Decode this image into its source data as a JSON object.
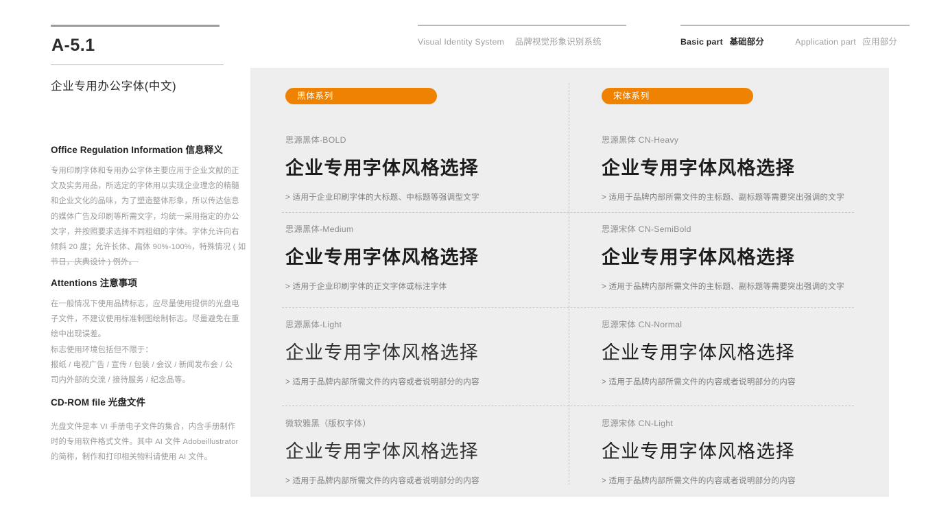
{
  "sidebar": {
    "page_code": "A-5.1",
    "title": "企业专用办公字体(中文)",
    "sections": [
      {
        "heading_en": "Office Regulation Information",
        "heading_cn": "信息释义",
        "body_lines": [
          "专用印刷字体和专用办公字体主要应用于企业文献的正",
          "文及实务用品，所选定的字体用以实现企业理念的精髓",
          "和企业文化的品味，为了塑造整体形象，所以传达信息",
          "的媒体广告及印刷等所需文字，均统一采用指定的办公",
          "文字，并按照要求选择不同粗细的字体。字体允许向右",
          "倾斜 20 度；允许长体、扁体 90%-100%，特殊情况 ( 如",
          "节日，庆典设计 ) 例外。"
        ]
      },
      {
        "heading_en": "Attentions",
        "heading_cn": "注意事项",
        "body_lines": [
          "在一般情况下使用品牌标志，应尽量使用提供的光盘电",
          "子文件，不建议使用标准制图绘制标志。尽量避免在重",
          "绘中出现误差。",
          "标志使用环境包括但不限于：",
          "报纸 / 电视广告 / 宣传 / 包装 / 会议 / 新闻发布会 / 公",
          "司内外部的交流 / 接待服务 / 纪念品等。"
        ]
      },
      {
        "heading_en": "CD-ROM file",
        "heading_cn": "光盘文件",
        "body_lines": [
          "光盘文件是本 VI 手册电子文件的集合，内含手册制作",
          "时的专用软件格式文件。其中 AI 文件 Adobeillustrator",
          "的简称，制作和打印相关物料请使用 AI 文件。"
        ]
      }
    ]
  },
  "header": {
    "left_group": [
      {
        "en": "Visual Identity System",
        "cn": "品牌视觉形象识别系统",
        "active": false
      }
    ],
    "right_group": [
      {
        "en": "Basic part",
        "cn": "基础部分",
        "active": true
      },
      {
        "en": "Application part",
        "cn": "应用部分",
        "active": false
      }
    ]
  },
  "panel": {
    "accent_color": "#ef8200",
    "background_color": "#eeeeee",
    "badges": {
      "left": "黑体系列",
      "right": "宋体系列"
    },
    "left_column": [
      {
        "name": "思源黑体-BOLD",
        "sample": "企业专用字体风格选择",
        "note": "> 适用于企业印刷字体的大标题、中标题等强调型文字"
      },
      {
        "name": "思源黑体-Medium",
        "sample": "企业专用字体风格选择",
        "note": "> 适用于企业印刷字体的正文字体或标注字体"
      },
      {
        "name": "思源黑体-Light",
        "sample": "企业专用字体风格选择",
        "note": "> 适用于品牌内部所需文件的内容或者说明部分的内容"
      },
      {
        "name": "微软雅黑（版权字体）",
        "sample": "企业专用字体风格选择",
        "note": "> 适用于品牌内部所需文件的内容或者说明部分的内容"
      }
    ],
    "right_column": [
      {
        "name": "思源黑体 CN-Heavy",
        "sample": "企业专用字体风格选择",
        "note": "> 适用于品牌内部所需文件的主标题、副标题等需要突出强调的文字"
      },
      {
        "name": "思源宋体 CN-SemiBold",
        "sample": "企业专用字体风格选择",
        "note": "> 适用于品牌内部所需文件的主标题、副标题等需要突出强调的文字"
      },
      {
        "name": "思源宋体 CN-Normal",
        "sample": "企业专用字体风格选择",
        "note": "> 适用于品牌内部所需文件的内容或者说明部分的内容"
      },
      {
        "name": "思源宋体 CN-Light",
        "sample": "企业专用字体风格选择",
        "note": "> 适用于品牌内部所需文件的内容或者说明部分的内容"
      }
    ]
  }
}
